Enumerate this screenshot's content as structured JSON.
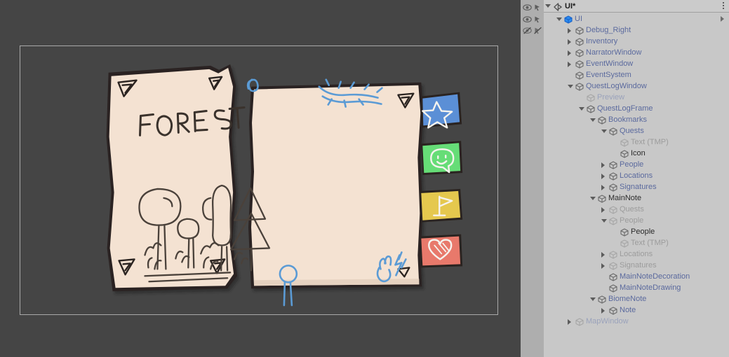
{
  "window": {
    "background_color": "#454545",
    "panel_color": "#c8c8c8",
    "gutter_color": "#aeaeae"
  },
  "hierarchy": {
    "scene_title": "UI*",
    "scene_icon": "unity-scene-icon",
    "menu_icon": "kebab-menu-icon",
    "expand_chevron_icon": "chevron-right-icon",
    "toggle_columns": [
      {
        "eye": "eye-visible-icon",
        "pick": "picking-enabled-icon"
      },
      {
        "eye": "eye-visible-icon",
        "pick": "picking-enabled-icon"
      },
      {
        "eye": "eye-hidden-icon",
        "pick": "picking-disabled-icon"
      }
    ],
    "items": [
      {
        "label": "UI",
        "depth": 0,
        "toggle": "open",
        "active": true,
        "prefab": true,
        "root": true
      },
      {
        "label": "Debug_Right",
        "depth": 1,
        "toggle": "closed",
        "active": true,
        "prefab": true
      },
      {
        "label": "Inventory",
        "depth": 1,
        "toggle": "closed",
        "active": true,
        "prefab": true
      },
      {
        "label": "NarratorWindow",
        "depth": 1,
        "toggle": "closed",
        "active": true,
        "prefab": true
      },
      {
        "label": "EventWindow",
        "depth": 1,
        "toggle": "closed",
        "active": true,
        "prefab": true
      },
      {
        "label": "EventSystem",
        "depth": 1,
        "toggle": "none",
        "active": true,
        "prefab": true
      },
      {
        "label": "QuestLogWindow",
        "depth": 1,
        "toggle": "open",
        "active": true,
        "prefab": true
      },
      {
        "label": "Preview",
        "depth": 2,
        "toggle": "none",
        "active": false,
        "prefab": true
      },
      {
        "label": "QuestLogFrame",
        "depth": 2,
        "toggle": "open",
        "active": true,
        "prefab": true
      },
      {
        "label": "Bookmarks",
        "depth": 3,
        "toggle": "open",
        "active": true,
        "prefab": true
      },
      {
        "label": "Quests",
        "depth": 4,
        "toggle": "open",
        "active": true,
        "prefab": true
      },
      {
        "label": "Text (TMP)",
        "depth": 5,
        "toggle": "none",
        "active": false,
        "prefab": false
      },
      {
        "label": "Icon",
        "depth": 5,
        "toggle": "none",
        "active": true,
        "prefab": false
      },
      {
        "label": "People",
        "depth": 4,
        "toggle": "closed",
        "active": true,
        "prefab": true
      },
      {
        "label": "Locations",
        "depth": 4,
        "toggle": "closed",
        "active": true,
        "prefab": true
      },
      {
        "label": "Signatures",
        "depth": 4,
        "toggle": "closed",
        "active": true,
        "prefab": true
      },
      {
        "label": "MainNote",
        "depth": 3,
        "toggle": "open",
        "active": true,
        "prefab": false
      },
      {
        "label": "Quests",
        "depth": 4,
        "toggle": "closed",
        "active": false,
        "prefab": false
      },
      {
        "label": "People",
        "depth": 4,
        "toggle": "open",
        "active": false,
        "prefab": false
      },
      {
        "label": "People",
        "depth": 5,
        "toggle": "none",
        "active": true,
        "prefab": false
      },
      {
        "label": "Text (TMP)",
        "depth": 5,
        "toggle": "none",
        "active": false,
        "prefab": false
      },
      {
        "label": "Locations",
        "depth": 4,
        "toggle": "closed",
        "active": false,
        "prefab": false
      },
      {
        "label": "Signatures",
        "depth": 4,
        "toggle": "closed",
        "active": false,
        "prefab": false
      },
      {
        "label": "MainNoteDecoration",
        "depth": 4,
        "toggle": "none",
        "active": true,
        "prefab": true
      },
      {
        "label": "MainNoteDrawing",
        "depth": 4,
        "toggle": "none",
        "active": true,
        "prefab": true
      },
      {
        "label": "BiomeNote",
        "depth": 3,
        "toggle": "open",
        "active": true,
        "prefab": true
      },
      {
        "label": "Note",
        "depth": 4,
        "toggle": "closed",
        "active": true,
        "prefab": true
      },
      {
        "label": "MapWindow",
        "depth": 1,
        "toggle": "closed",
        "active": false,
        "prefab": true
      }
    ]
  },
  "game_view": {
    "paper_color": "#f4e2d2",
    "ink_color": "#2a2320",
    "doodle_color": "#5b9bd5",
    "left_note": {
      "title": "FOREST",
      "drawing": "forest-sketch-trees-and-figures"
    },
    "right_note": {
      "title": "",
      "doodles": [
        "paperclip-doodle",
        "vine-doodle",
        "stick-figure-doodle",
        "hand-doodle",
        "arrow-doodle"
      ]
    },
    "bookmarks": [
      {
        "name": "quests-bookmark",
        "icon": "star-icon",
        "color": "#5b8fd6"
      },
      {
        "name": "people-bookmark",
        "icon": "smiley-icon",
        "color": "#66dd77"
      },
      {
        "name": "locations-bookmark",
        "icon": "flag-icon",
        "color": "#e5c84e"
      },
      {
        "name": "signatures-bookmark",
        "icon": "heart-icon",
        "color": "#e8796b"
      }
    ]
  }
}
